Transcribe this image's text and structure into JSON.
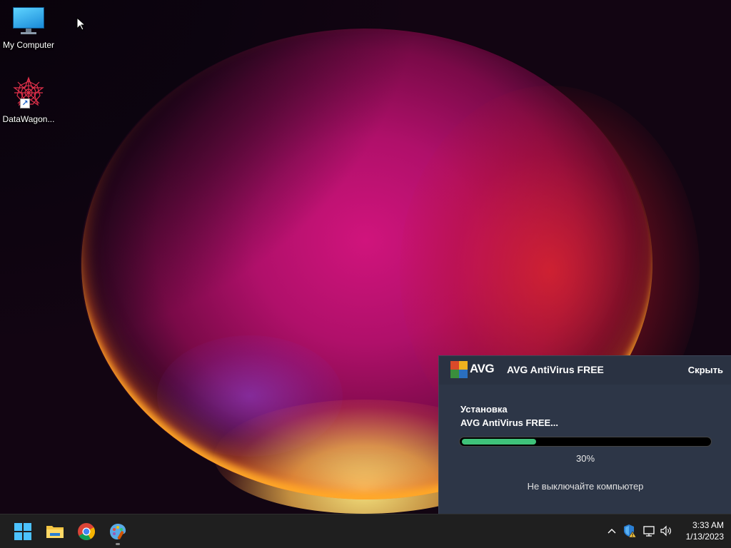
{
  "desktop": {
    "icons": [
      {
        "label": "My Computer"
      },
      {
        "label": "DataWagon..."
      }
    ]
  },
  "avg_dialog": {
    "logo_text": "AVG",
    "title": "AVG AntiVirus FREE",
    "hide_label": "Скрыть",
    "status_line1": "Установка",
    "status_line2": "AVG AntiVirus FREE...",
    "progress_fraction": 0.3,
    "progress_label": "30%",
    "warning": "Не выключайте компьютер",
    "colors": {
      "background": "#2d3647",
      "progress_fill": "#3fc27a",
      "progress_track": "#000000"
    }
  },
  "taskbar": {
    "apps": [
      {
        "name": "start-button-icon"
      },
      {
        "name": "file-explorer-icon"
      },
      {
        "name": "chrome-icon"
      },
      {
        "name": "paint-icon",
        "running": true
      }
    ],
    "tray": [
      "chevron-up-icon",
      "defender-shield-warning-icon",
      "network-icon",
      "volume-icon"
    ],
    "clock": {
      "time": "3:33 AM",
      "date": "1/13/2023"
    }
  }
}
